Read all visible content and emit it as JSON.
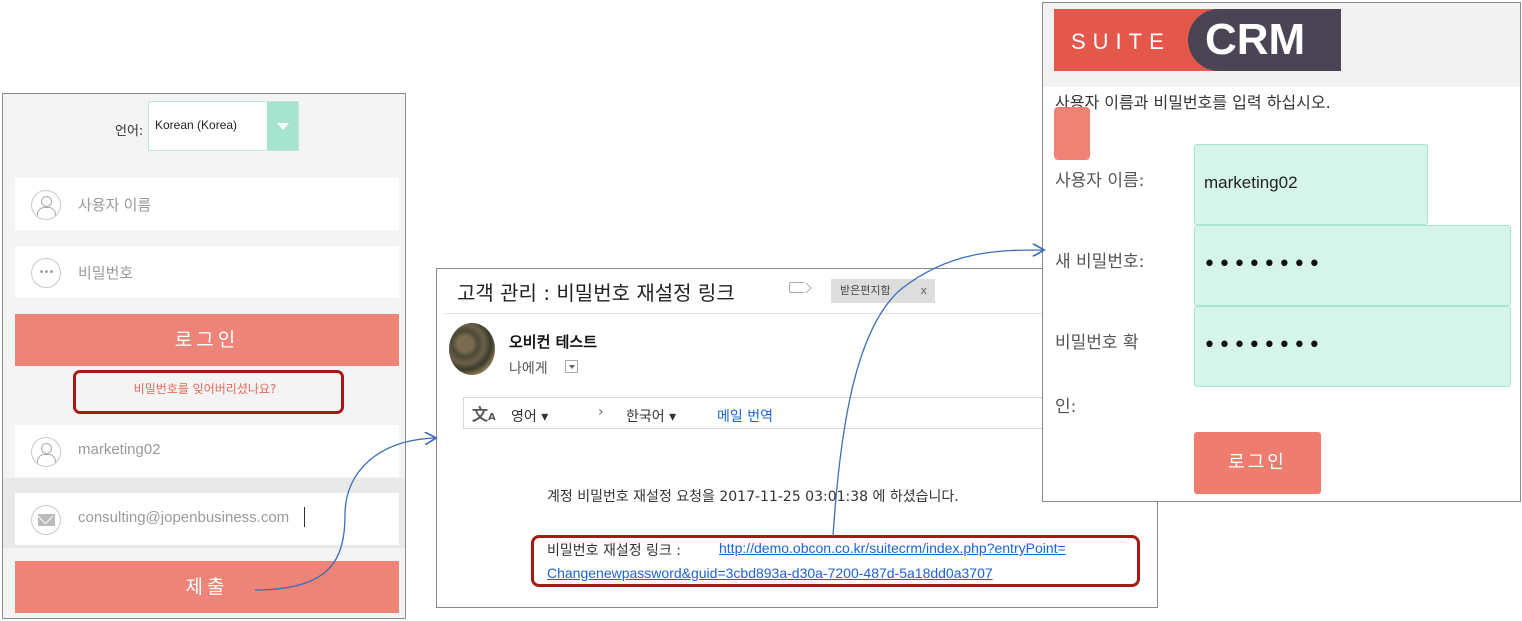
{
  "login_panel": {
    "language_label": "언어:",
    "language_value": "Korean (Korea)",
    "username_placeholder": "사용자 이름",
    "password_placeholder": "비밀번호",
    "login_label": "로그인",
    "forgot_link": "비밀번호를 잊어버리셨나요?",
    "reset_username_value": "marketing02",
    "reset_email_value": "consulting@jopenbusiness.com",
    "submit_label": "제출",
    "colors": {
      "button": "#ee8477",
      "highlight_box": "#a51b14",
      "accent_mint": "#a6e4d0"
    }
  },
  "email_panel": {
    "subject": "고객 관리 : 비밀번호 재설정 링크",
    "label_chip": "받은편지함",
    "label_chip_close": "x",
    "sender_name": "오비컨 테스트",
    "recipient": "나에게",
    "translate_icon": "translate-icon",
    "translate_from": "영어",
    "translate_arrow": "›",
    "translate_to": "한국어",
    "translate_action": "메일 번역",
    "body_text": "계정 비밀번호 재설정 요청을 2017-11-25 03:01:38 에 하셨습니다.",
    "reset_link_label": "비밀번호 재설정 링크 :",
    "reset_link_url_line1": "http://demo.obcon.co.kr/suitecrm/index.php?entryPoint=",
    "reset_link_url_line2": "Changenewpassword&guid=3cbd893a-d30a-7200-487d-5a18dd0a3707"
  },
  "crm_panel": {
    "logo_suite": "SUITE",
    "logo_crm": "CRM",
    "instruction": "사용자 이름과 비밀번호를 입력 하십시오.",
    "username_label": "사용자 이름:",
    "username_value": "marketing02",
    "new_password_label": "새 비밀번호:",
    "new_password_value": "••••••••",
    "confirm_label_line1": "비밀번호 확",
    "confirm_label_line2": "인:",
    "confirm_value": "••••••••",
    "login_label": "로그인",
    "colors": {
      "logo_red": "#e4584b",
      "logo_dark": "#4a4455",
      "input_mint": "#d6f5ea"
    }
  }
}
